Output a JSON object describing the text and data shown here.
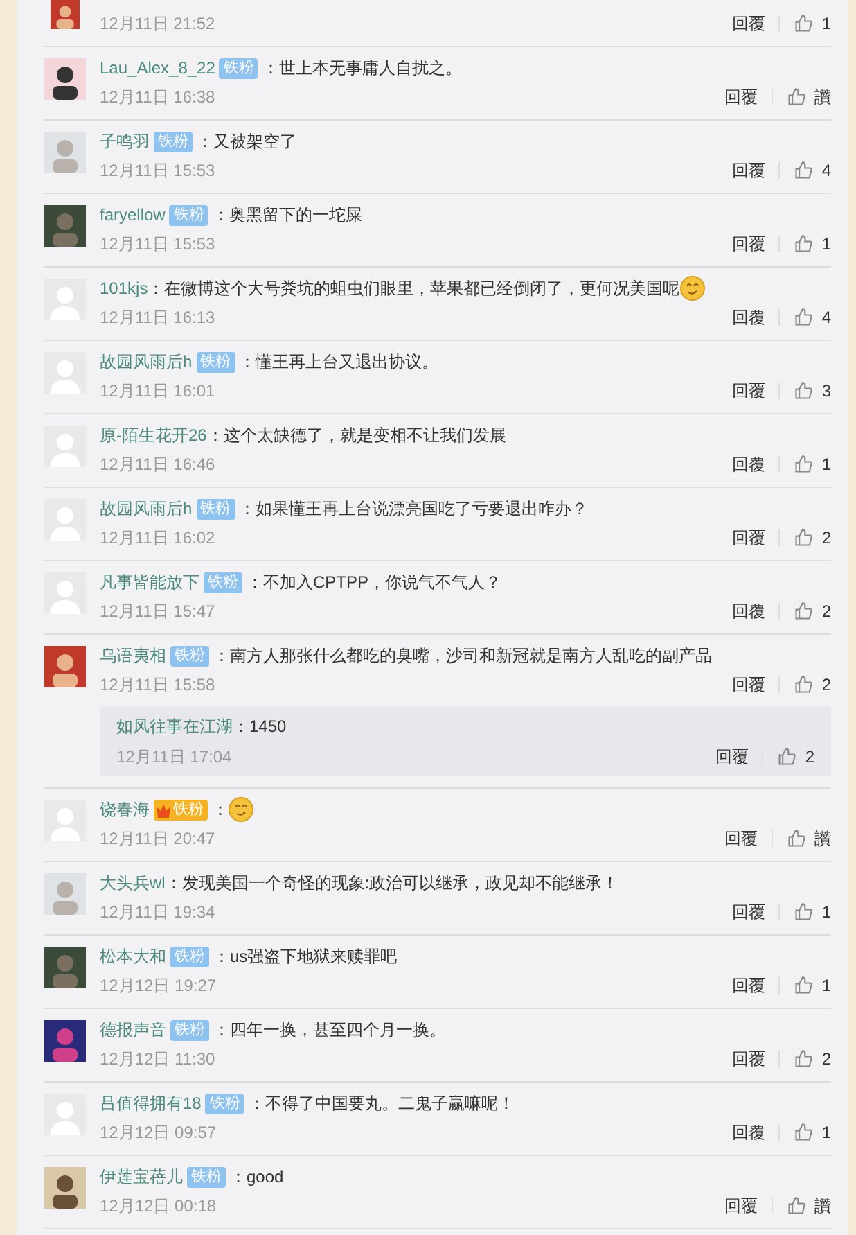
{
  "comments": [
    {
      "time": "12月11日 21:52",
      "reply": "回覆",
      "likes": "1",
      "partial": true
    },
    {
      "name": "Lau_Alex_8_22",
      "badge": {
        "kind": "fan",
        "text": "铁粉"
      },
      "text": "：世上本无事庸人自扰之。",
      "time": "12月11日 16:38",
      "reply": "回覆",
      "likes": "讚"
    },
    {
      "name": "子鸣羽",
      "badge": {
        "kind": "fan",
        "text": "铁粉"
      },
      "text": "：又被架空了",
      "time": "12月11日 15:53",
      "reply": "回覆",
      "likes": "4"
    },
    {
      "name": "faryellow",
      "badge": {
        "kind": "fan",
        "text": "铁粉"
      },
      "text": "：奥黑留下的一坨屎",
      "time": "12月11日 15:53",
      "reply": "回覆",
      "likes": "1"
    },
    {
      "avatar": {
        "kind": "default"
      },
      "name": "101kjs",
      "text": "：在微博这个大号粪坑的蛆虫们眼里，苹果都已经倒闭了，更何况美国呢",
      "emoji": true,
      "time": "12月11日 16:13",
      "reply": "回覆",
      "likes": "4"
    },
    {
      "avatar": {
        "kind": "default"
      },
      "name": "故园风雨后h",
      "badge": {
        "kind": "fan",
        "text": "铁粉"
      },
      "text": "：懂王再上台又退出协议。",
      "time": "12月11日 16:01",
      "reply": "回覆",
      "likes": "3"
    },
    {
      "avatar": {
        "kind": "default"
      },
      "name": "原-陌生花开26",
      "text": "：这个太缺德了，就是变相不让我们发展",
      "time": "12月11日 16:46",
      "reply": "回覆",
      "likes": "1"
    },
    {
      "avatar": {
        "kind": "default"
      },
      "name": "故园风雨后h",
      "badge": {
        "kind": "fan",
        "text": "铁粉"
      },
      "text": "：如果懂王再上台说漂亮国吃了亏要退出咋办？",
      "time": "12月11日 16:02",
      "reply": "回覆",
      "likes": "2"
    },
    {
      "avatar": {
        "kind": "default"
      },
      "name": "凡事皆能放下",
      "badge": {
        "kind": "fan",
        "text": "铁粉"
      },
      "text": "：不加入CPTPP，你说气不气人？",
      "time": "12月11日 15:47",
      "reply": "回覆",
      "likes": "2"
    },
    {
      "name": "乌语夷相",
      "badge": {
        "kind": "fan",
        "text": "铁粉"
      },
      "text": "：南方人那张什么都吃的臭嘴，沙司和新冠就是南方人乱吃的副产品",
      "time": "12月11日 15:58",
      "reply": "回覆",
      "likes": "2",
      "replies": [
        {
          "name": "如风往事在江湖",
          "text": "：1450",
          "time": "12月11日 17:04",
          "reply": "回覆",
          "likes": "2"
        }
      ]
    },
    {
      "avatar": {
        "kind": "default"
      },
      "name": "饶春海",
      "badge": {
        "kind": "gold",
        "text": "铁粉"
      },
      "text": "：",
      "emoji": true,
      "time": "12月11日 20:47",
      "reply": "回覆",
      "likes": "讚"
    },
    {
      "name": "大头兵wl",
      "text": "：发现美国一个奇怪的现象:政治可以继承，政见却不能继承！",
      "time": "12月11日 19:34",
      "reply": "回覆",
      "likes": "1"
    },
    {
      "name": "松本大和",
      "badge": {
        "kind": "fan",
        "text": "铁粉"
      },
      "text": "：us强盗下地狱来赎罪吧",
      "time": "12月12日 19:27",
      "reply": "回覆",
      "likes": "1"
    },
    {
      "name": "德报声音",
      "badge": {
        "kind": "fan",
        "text": "铁粉"
      },
      "text": "：四年一换，甚至四个月一换。",
      "time": "12月12日 11:30",
      "reply": "回覆",
      "likes": "2"
    },
    {
      "avatar": {
        "kind": "default"
      },
      "name": "吕值得拥有18",
      "badge": {
        "kind": "fan",
        "text": "铁粉"
      },
      "text": "：不得了中国要丸。二鬼子赢嘛呢！",
      "time": "12月12日 09:57",
      "reply": "回覆",
      "likes": "1"
    },
    {
      "name": "伊莲宝蓓儿",
      "badge": {
        "kind": "fan",
        "text": "铁粉"
      },
      "text": "：good",
      "time": "12月12日 00:18",
      "reply": "回覆",
      "likes": "讚"
    }
  ]
}
